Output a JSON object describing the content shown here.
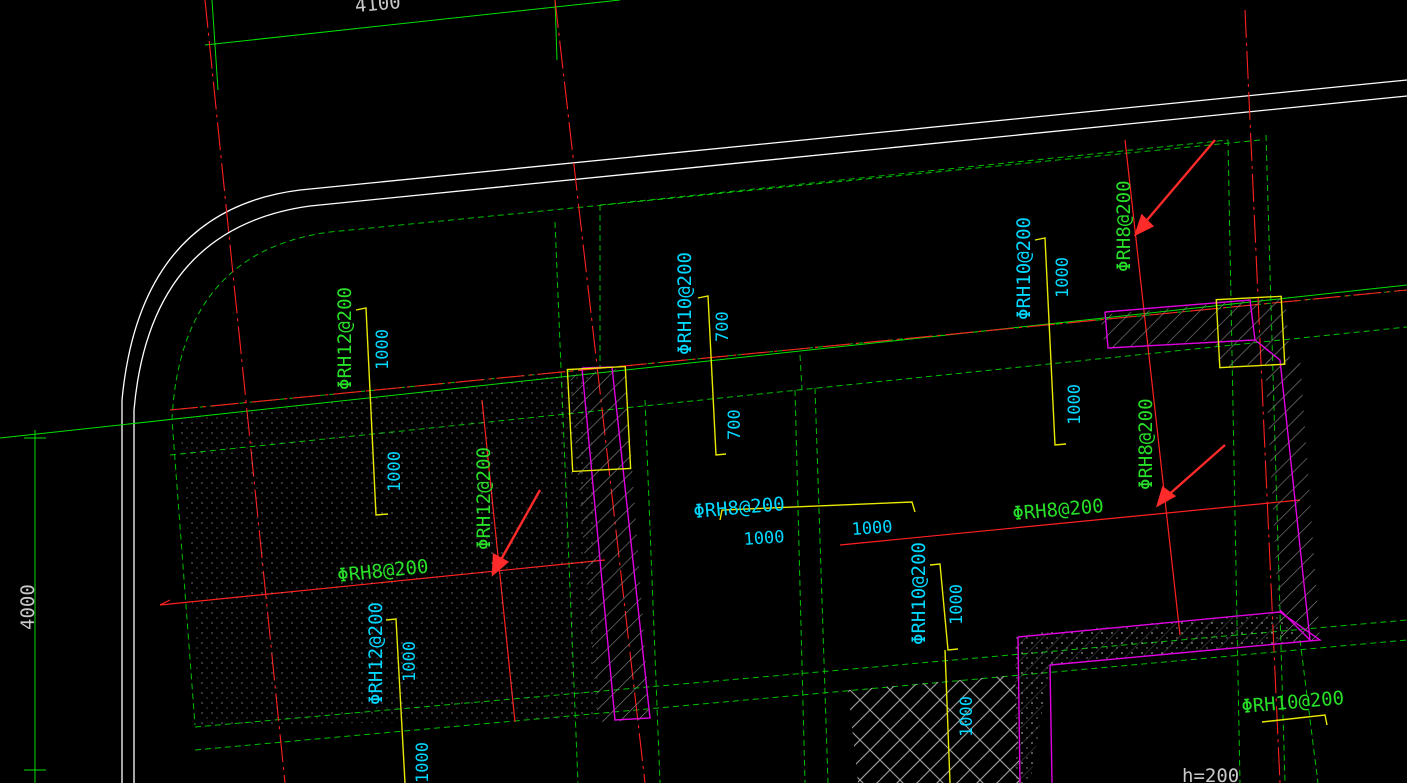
{
  "app": {
    "type": "cad-viewport"
  },
  "colors": {
    "background": "#000000",
    "slab_edge": "#ffffff",
    "axis_line": "#ff2020",
    "grid_green": "#00e000",
    "rebar_green_text": "#28e028",
    "rebar_cyan_text": "#00d8ff",
    "extent_yellow": "#e8e800",
    "section_magenta": "#e000e0",
    "hatch_gray": "#9a9a9a",
    "callout_arrow": "#ff2a2a"
  },
  "dimensions": {
    "top": "4100",
    "left": "4000",
    "bottom_right": "h=200"
  },
  "rebar_labels": {
    "left_top_vertical": "ΦRH12@200",
    "left_middle_vertical": "ΦRH12@200",
    "left_bottom_vertical": "ΦRH12@200",
    "left_horizontal": "ΦRH8@200",
    "middle_top_vertical": "ΦRH10@200",
    "middle_horizontal": "ΦRH8@200",
    "middle_lower_vertical": "ΦRH10@200",
    "right_top_vertical_cyan": "ΦRH10@200",
    "right_top_vertical_green": "ΦRH8@200",
    "right_middle_vertical_green": "ΦRH8@200",
    "right_horizontal": "ΦRH8@200",
    "far_right_bottom": "ΦRH10@200"
  },
  "lengths": {
    "left_top_upper": "1000",
    "left_top_lower": "1000",
    "left_bottom": "1000",
    "left_bottom_cut": "1000",
    "middle_top_upper": "700",
    "middle_top_lower": "700",
    "middle_horizontal_left": "1000",
    "middle_horizontal_right": "1000",
    "middle_lower": "1000",
    "middle_lowest": "1000",
    "right_top_upper": "1000",
    "right_top_lower": "1000"
  }
}
